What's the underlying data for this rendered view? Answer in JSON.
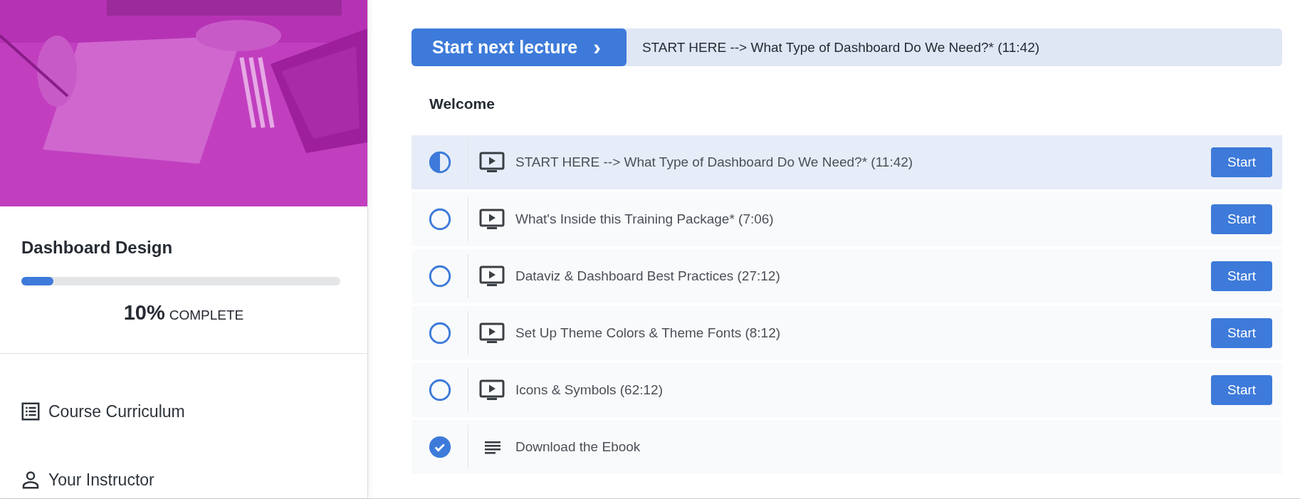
{
  "sidebar": {
    "course_title": "Dashboard Design",
    "progress": {
      "level": 0.1,
      "percent": "10%",
      "label": "COMPLETE"
    },
    "nav": [
      {
        "label": "Course Curriculum"
      },
      {
        "label": "Your Instructor"
      }
    ]
  },
  "next_lecture": {
    "button": "Start next lecture",
    "icon": "›",
    "title": "START HERE --> What Type of Dashboard Do We Need?* (11:42)"
  },
  "section": {
    "title": "Welcome",
    "lectures": [
      {
        "title": "START HERE --> What Type of Dashboard Do We Need?* (11:42)",
        "kind": "video",
        "completed": false,
        "in_progress": true,
        "selected": true,
        "button": "Start"
      },
      {
        "title": "What's Inside this Training Package* (7:06)",
        "kind": "video",
        "completed": false,
        "in_progress": false,
        "selected": false,
        "button": "Start"
      },
      {
        "title": "Dataviz & Dashboard Best Practices (27:12)",
        "kind": "video",
        "completed": false,
        "in_progress": false,
        "selected": false,
        "button": "Start"
      },
      {
        "title": "Set Up Theme Colors & Theme Fonts (8:12)",
        "kind": "video",
        "completed": false,
        "in_progress": false,
        "selected": false,
        "button": "Start"
      },
      {
        "title": "Icons & Symbols (62:12)",
        "kind": "video",
        "completed": false,
        "in_progress": false,
        "selected": false,
        "button": "Start"
      },
      {
        "title": "Download the Ebook",
        "kind": "text",
        "completed": true,
        "in_progress": false,
        "selected": false
      }
    ]
  }
}
